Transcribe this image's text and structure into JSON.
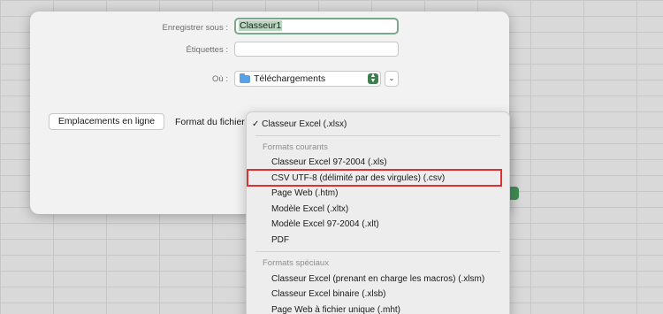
{
  "dialog": {
    "save_as_label": "Enregistrer sous :",
    "save_as_value": "Classeur1",
    "tags_label": "Étiquettes :",
    "tags_value": "",
    "where_label": "Où :",
    "where_value": "Téléchargements",
    "online_locations_button": "Emplacements en ligne",
    "file_format_label": "Format du fichier"
  },
  "format_menu": {
    "selected": "Classeur Excel (.xlsx)",
    "common_header": "Formats courants",
    "common_items": [
      "Classeur Excel 97-2004 (.xls)",
      "CSV UTF-8 (délimité par des virgules) (.csv)",
      "Page Web (.htm)",
      "Modèle Excel (.xltx)",
      "Modèle Excel 97-2004 (.xlt)",
      "PDF"
    ],
    "special_header": "Formats spéciaux",
    "special_items": [
      "Classeur Excel (prenant en charge les macros) (.xlsm)",
      "Classeur Excel binaire (.xlsb)",
      "Page Web à fichier unique (.mht)"
    ],
    "highlight_color": "#e0302f"
  },
  "colors": {
    "accent_green": "#3f8a54",
    "folder_blue": "#5aa0e6"
  }
}
